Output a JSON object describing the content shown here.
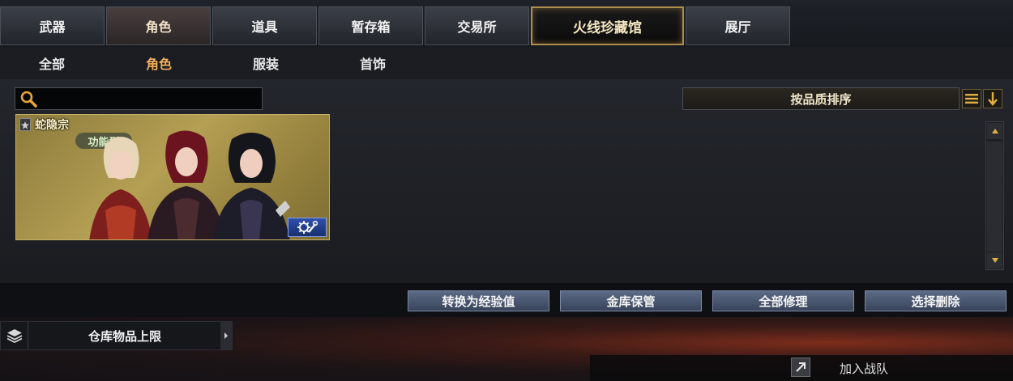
{
  "tabs": [
    {
      "label": "武器"
    },
    {
      "label": "角色"
    },
    {
      "label": "道具"
    },
    {
      "label": "暂存箱"
    },
    {
      "label": "交易所"
    },
    {
      "label": "火线珍藏馆"
    },
    {
      "label": "展厅"
    }
  ],
  "selected_tab": "角色",
  "featured_tab": "火线珍藏馆",
  "subtabs": [
    {
      "label": "全部"
    },
    {
      "label": "角色"
    },
    {
      "label": "服装"
    },
    {
      "label": "首饰"
    }
  ],
  "selected_subtab": "角色",
  "search": {
    "value": "",
    "placeholder": ""
  },
  "sort": {
    "label": "按品质排序"
  },
  "item": {
    "name": "蛇隐宗",
    "type": "功能型"
  },
  "actions": {
    "convert": "转换为经验值",
    "vault": "金库保管",
    "repair_all": "全部修理",
    "select_delete": "选择删除"
  },
  "storage_limit_label": "仓库物品上限",
  "join_team": "加入战队",
  "colors": {
    "accent": "#f0b05c",
    "featured_border": "#b08d4e",
    "action_button": "#4a5670"
  }
}
